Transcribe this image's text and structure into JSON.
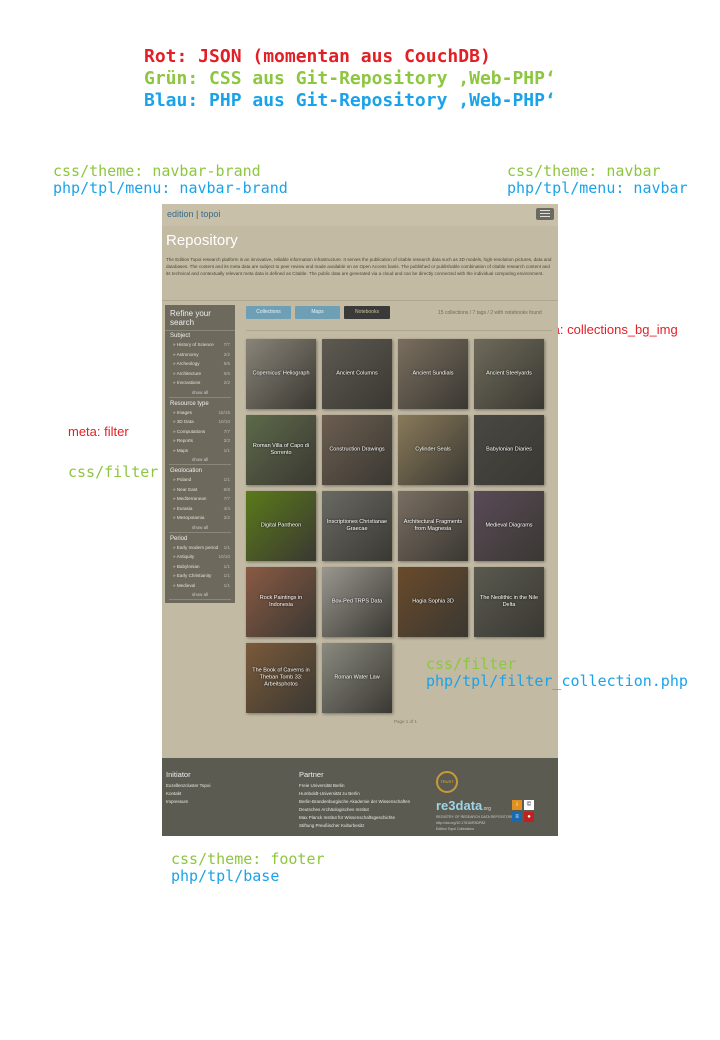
{
  "legend": {
    "red": "Rot: JSON (momentan aus CouchDB)",
    "green": "Grün: CSS aus Git-Repository ‚Web-PHP‘",
    "blue": "Blau: PHP aus Git-Repository ‚Web-PHP‘"
  },
  "annotations": {
    "brand_css": "css/theme: navbar-brand",
    "brand_php": "php/tpl/menu: navbar-brand",
    "navbar_css": "css/theme: navbar",
    "navbar_php": "php/tpl/menu: navbar",
    "meta_bg": "meta: collections_bg_img",
    "meta_filter": "meta: filter",
    "css_filter_left": "css/filter",
    "css_filter_right": "css/filter",
    "php_filter_collection": "php/tpl/filter_collection.php",
    "footer_css": "css/theme: footer",
    "footer_php": "php/tpl/base"
  },
  "colors": {
    "red": "#e31e24",
    "green": "#8dc63f",
    "blue": "#1aa3e8"
  },
  "site": {
    "brand_left": "edition",
    "brand_right": "topoi",
    "menu_icon": "hamburger-icon",
    "title": "Repository",
    "intro": "The Edition Topoi research platform is an innovative, reliable information infrastructure. It serves the publication of citable research data such as 3D models, high-resolution pictures, data and databases. The content and its meta data are subject to peer review and made available on an Open Access basis. The published or publishable combination of citable research content and its technical and contextually relevant meta data is defined as Citable. The public data are generated via a cloud and can be directly connected with the individual computing environment."
  },
  "sidebar": {
    "heading": "Refine your search",
    "show_all": "show all",
    "groups": [
      {
        "name": "Subject",
        "items": [
          [
            "» History of Science",
            "7/7"
          ],
          [
            "» Astronomy",
            "2/2"
          ],
          [
            "» Archeology",
            "5/5"
          ],
          [
            "» Architecture",
            "6/6"
          ],
          [
            "» Innovations",
            "2/2"
          ]
        ]
      },
      {
        "name": "Resource type",
        "items": [
          [
            "» Images",
            "15/15"
          ],
          [
            "» 3D Data",
            "10/10"
          ],
          [
            "» Computations",
            "7/7"
          ],
          [
            "» Reports",
            "2/2"
          ],
          [
            "» Maps",
            "1/1"
          ]
        ]
      },
      {
        "name": "Geolocation",
        "items": [
          [
            "» Poland",
            "1/1"
          ],
          [
            "» Near East",
            "8/8"
          ],
          [
            "» Mediterranean",
            "7/7"
          ],
          [
            "» Eurasia",
            "4/4"
          ],
          [
            "» Mesopotamia",
            "2/2"
          ]
        ]
      },
      {
        "name": "Period",
        "items": [
          [
            "» Early modern period",
            "1/1"
          ],
          [
            "» Antiquity",
            "10/10"
          ],
          [
            "» Babylonian",
            "1/1"
          ],
          [
            "» Early Christianity",
            "1/1"
          ],
          [
            "» Medieval",
            "1/1"
          ]
        ]
      }
    ]
  },
  "tabs": [
    {
      "label": "Collections",
      "color": "#6f9fb4"
    },
    {
      "label": "Maps",
      "color": "#6f9fb4"
    },
    {
      "label": "Notebooks",
      "color": "#3a3a38"
    }
  ],
  "result_count": "15 collections / 7 tags / 2 with notebooks found",
  "tiles": [
    {
      "label": "Copernicus' Heliograph",
      "bg": "#8a8478"
    },
    {
      "label": "Ancient Columns",
      "bg": "#5e5a52"
    },
    {
      "label": "Ancient Sundials",
      "bg": "#7a6e5e"
    },
    {
      "label": "Ancient Steelyards",
      "bg": "#6e6a5a"
    },
    {
      "label": "Roman Villa of Capo di Sorrento",
      "bg": "#5d6a4a"
    },
    {
      "label": "Construction Drawings",
      "bg": "#6c5e50"
    },
    {
      "label": "Cylinder Seals",
      "bg": "#8a7a5a"
    },
    {
      "label": "Babylonian Diaries",
      "bg": "#4a4842"
    },
    {
      "label": "Digital Pantheon",
      "bg": "#5a7a1a"
    },
    {
      "label": "Inscriptiones Christianae Graecae",
      "bg": "#6a6a64"
    },
    {
      "label": "Architectural Fragments from Magnesia",
      "bg": "#7a6e62"
    },
    {
      "label": "Medieval Diagrams",
      "bg": "#5a4a58"
    },
    {
      "label": "Rock Paintings in Indonesia",
      "bg": "#8a5a44"
    },
    {
      "label": "Bov-Ped TRPS Data",
      "bg": "#9a9690"
    },
    {
      "label": "Hagia Sophia 3D",
      "bg": "#6a4a2a"
    },
    {
      "label": "The Neolithic in the Nile Delta",
      "bg": "#5a5a50"
    },
    {
      "label": "The Book of Caverns in Theban Tomb 33: Arbeitsphotos",
      "bg": "#7a5a3a"
    },
    {
      "label": "Roman Water Law",
      "bg": "#8a8a80"
    }
  ],
  "pager": "Page 1 of 1",
  "footer": {
    "initiator_heading": "Initiator",
    "initiator_links": [
      "Exzellenzcluster Topoi",
      "Kontakt",
      "Impressum"
    ],
    "partner_heading": "Partner",
    "partner_links": [
      "Freie Universität Berlin",
      "Humboldt-Universität zu Berlin",
      "Berlin-Brandenburgische Akademie der Wissenschaften",
      "Deutsches Archäologisches Institut",
      "Max Planck Institut für Wissenschaftsgeschichte",
      "Stiftung Preußischer Kulturbesitz"
    ],
    "trust_badge": "TRUST",
    "re3data": "re3data",
    "re3data_suffix": ".org",
    "re3data_sub": "REGISTRY OF RESEARCH DATA REPOSITORIES",
    "doi": "http://doi.org/10.17616/R3DP8Z",
    "collection_name": "Edition Topoi Collections"
  }
}
